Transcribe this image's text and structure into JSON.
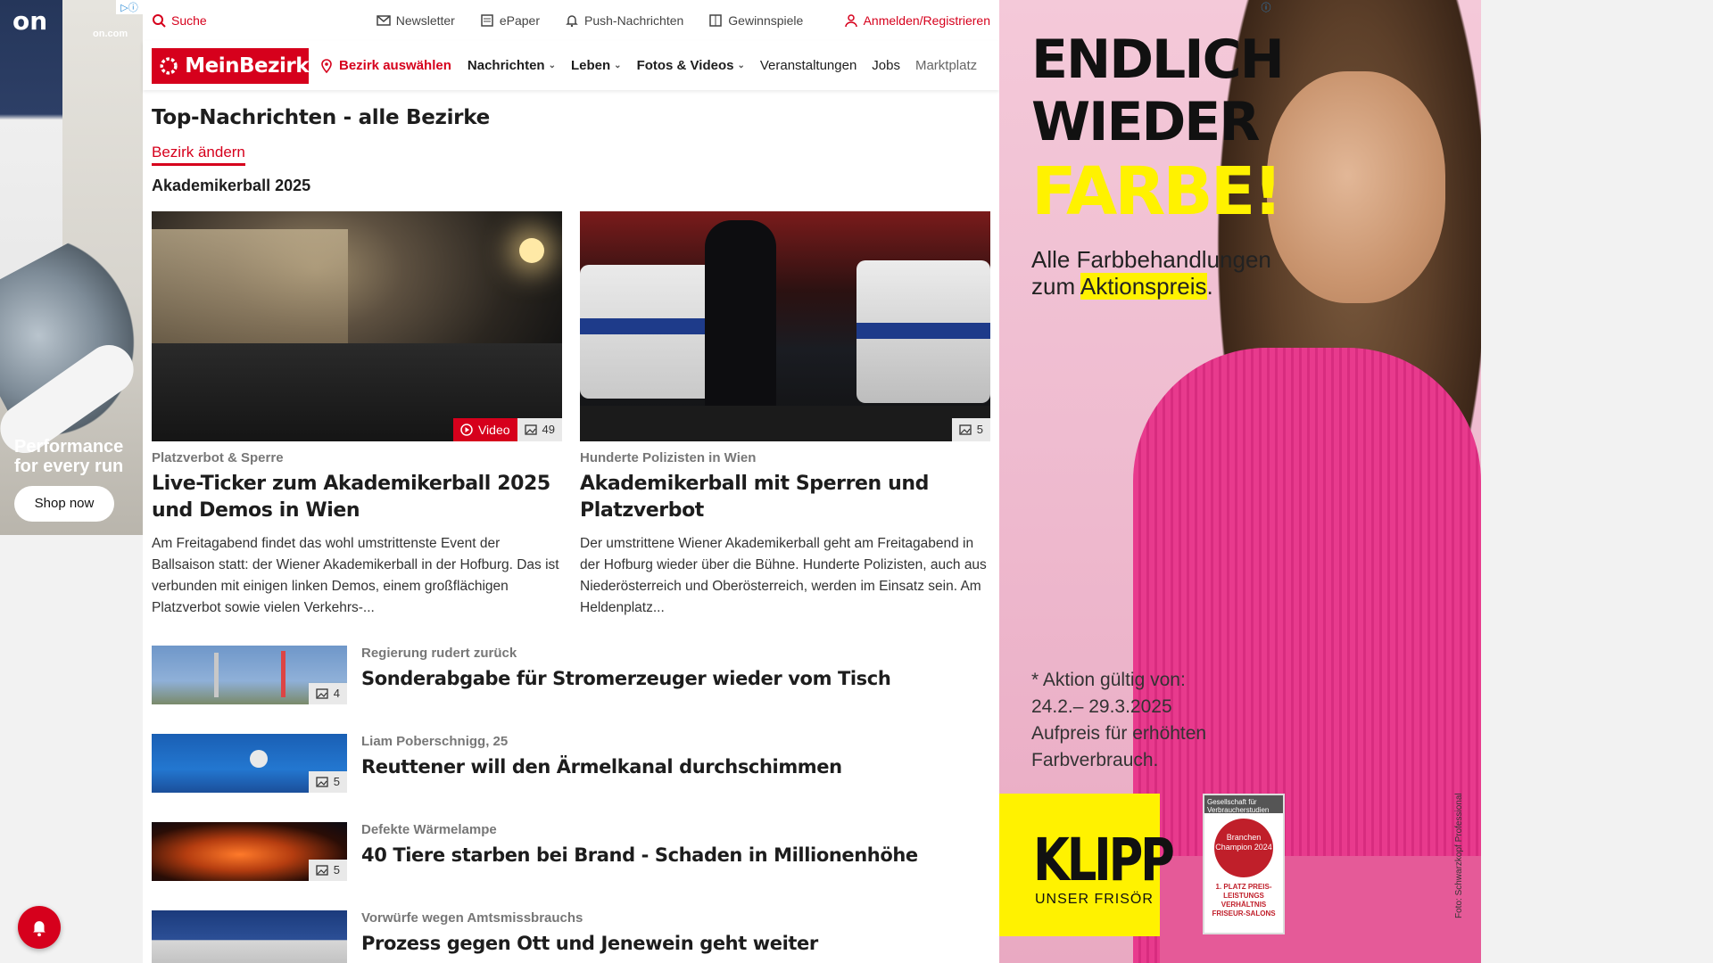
{
  "topbar": {
    "search": "Suche",
    "newsletter": "Newsletter",
    "epaper": "ePaper",
    "push": "Push-Nachrichten",
    "gewinnspiele": "Gewinnspiele",
    "login": "Anmelden/Registrieren"
  },
  "nav": {
    "logo": "MeinBezirk",
    "bezirk": "Bezirk auswählen",
    "items": [
      "Nachrichten",
      "Leben",
      "Fotos & Videos",
      "Veranstaltungen",
      "Jobs",
      "Marktplatz"
    ]
  },
  "page": {
    "title": "Top-Nachrichten - alle Bezirke",
    "change_link": "Bezirk ändern",
    "topic": "Akademikerball 2025"
  },
  "cards": [
    {
      "kicker": "Platzverbot & Sperre",
      "headline": "Live-Ticker zum Akademikerball 2025 und Demos in Wien",
      "teaser": "Am Freitagabend findet das wohl umstrittenste Event der Ballsaison statt: der Wiener Akademikerball in der Hofburg. Das ist verbunden mit einigen linken Demos, einem großflächigen Platzverbot sowie vielen Verkehrs-...",
      "video_label": "Video",
      "photo_count": "49"
    },
    {
      "kicker": "Hunderte Polizisten in Wien",
      "headline": "Akademikerball mit Sperren und Platzverbot",
      "teaser": "Der umstrittene Wiener Akademikerball geht am Freitagabend in der Hofburg wieder über die Bühne. Hunderte Polizisten, auch aus Niederösterreich und Oberösterreich, werden im Einsatz sein. Am Heldenplatz...",
      "photo_count": "5"
    }
  ],
  "list": [
    {
      "kicker": "Regierung rudert zurück",
      "headline": "Sonderabgabe für Stromerzeuger wieder vom Tisch",
      "photo_count": "4"
    },
    {
      "kicker": "Liam Poberschnigg, 25",
      "headline": "Reuttener will den Ärmelkanal durchschimmen",
      "photo_count": "5"
    },
    {
      "kicker": "Defekte Wärmelampe",
      "headline": "40 Tiere starben bei Brand - Schaden in Millionenhöhe",
      "photo_count": "5"
    },
    {
      "kicker": "Vorwürfe wegen Amtsmissbrauchs",
      "headline": "Prozess gegen Ott und Jenewein geht weiter",
      "photo_count": ""
    }
  ],
  "ad_left": {
    "logo": "on",
    "site": "on.com",
    "tagline": "Performance for every run",
    "button": "Shop now"
  },
  "ad_right": {
    "line1": "ENDLICH",
    "line2": "WIEDER",
    "line3": "FARBE!",
    "sub1": "Alle Farbbehandlungen",
    "sub2_pre": "zum ",
    "sub2_hl": "Aktionspreis",
    "sub2_post": ".",
    "note1": "* Aktion gültig von:",
    "note2": "24.2.– 29.3.2025",
    "note3": "Aufpreis für erhöhten",
    "note4": "Farbverbrauch.",
    "brand": "KLIPP",
    "brand_sub": "UNSER FRISÖR",
    "seal_top": "Gesellschaft für Verbraucherstudien GmbH",
    "seal_mid": "Branchen Champion 2024",
    "seal_bot": "1. PLATZ PREIS-LEISTUNGS VERHÄLTNIS FRISEUR-SALONS",
    "credit": "Foto: Schwarzkopf Professional"
  },
  "colors": {
    "brand": "#d6001c",
    "ad_yellow": "#fff200",
    "ad_pink": "#efbcd0"
  }
}
